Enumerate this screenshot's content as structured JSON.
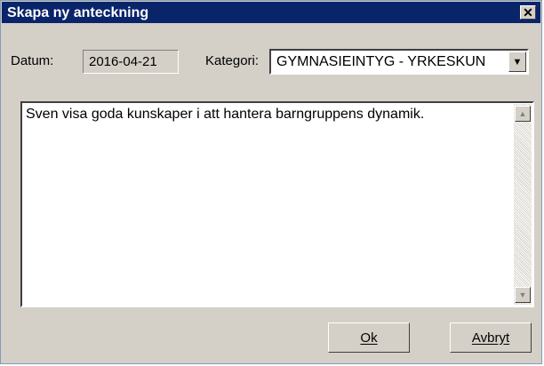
{
  "window": {
    "title": "Skapa ny anteckning"
  },
  "icons": {
    "close": "close-icon",
    "combo_arrow": "chevron-down-icon",
    "scroll_up": "arrow-up-icon",
    "scroll_down": "arrow-down-icon"
  },
  "form": {
    "date_label": "Datum:",
    "date_value": "2016-04-21",
    "category_label": "Kategori:",
    "category_value": "GYMNASIEINTYG - YRKESKUN"
  },
  "note": {
    "text": "Sven visa goda kunskaper i att hantera barngruppens dynamik."
  },
  "buttons": {
    "ok_label": "Ok",
    "cancel_label": "Avbryt"
  }
}
